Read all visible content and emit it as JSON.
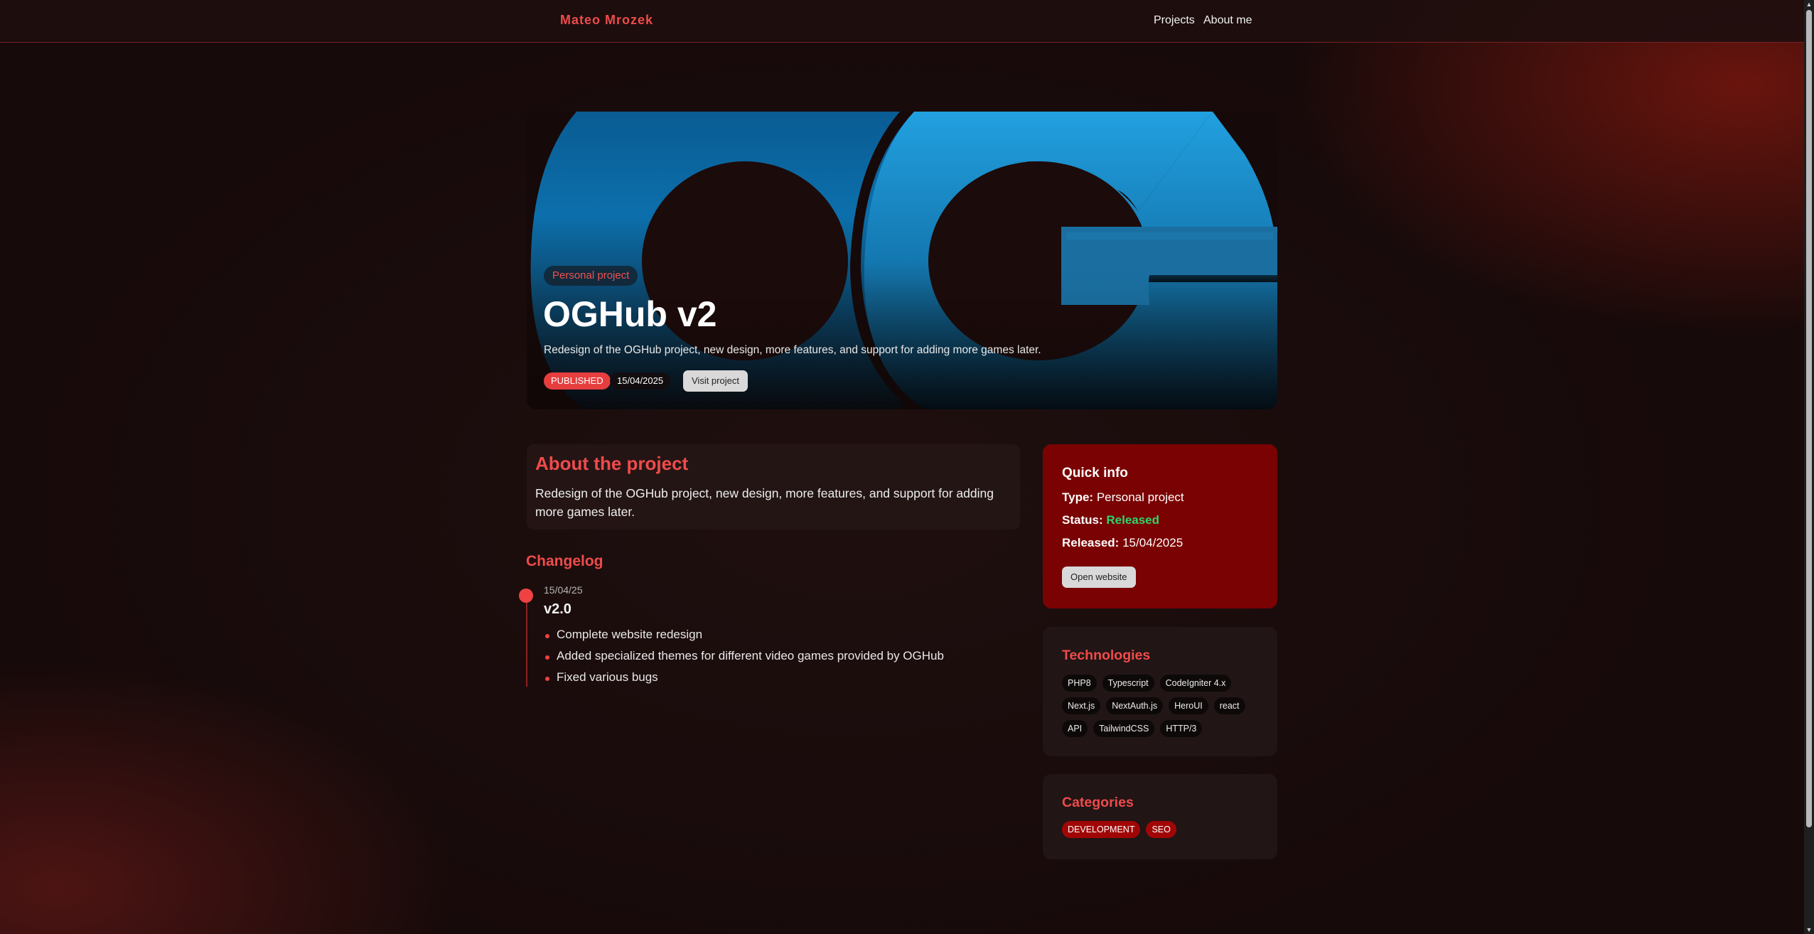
{
  "nav": {
    "brand": "Mateo Mrozek",
    "links": [
      "Projects",
      "About me"
    ]
  },
  "hero": {
    "type_badge": "Personal project",
    "title": "OGHub v2",
    "description": "Redesign of the OGHub project, new design, more features, and support for adding more games later.",
    "status_badge": "PUBLISHED",
    "date_badge": "15/04/2025",
    "visit_button": "Visit project"
  },
  "about": {
    "heading": "About the project",
    "text": "Redesign of the OGHub project, new design, more features, and support for adding more games later."
  },
  "changelog": {
    "heading": "Changelog",
    "entries": [
      {
        "date": "15/04/25",
        "version": "v2.0",
        "items": [
          "Complete website redesign",
          "Added specialized themes for different video games provided by OGHub",
          "Fixed various bugs"
        ]
      }
    ]
  },
  "quick_info": {
    "heading": "Quick info",
    "type_label": "Type:",
    "type_value": "Personal project",
    "status_label": "Status:",
    "status_value": "Released",
    "released_label": "Released:",
    "released_value": "15/04/2025",
    "button": "Open website"
  },
  "technologies": {
    "heading": "Technologies",
    "items": [
      "PHP8",
      "Typescript",
      "CodeIgniter 4.x",
      "Next.js",
      "NextAuth.js",
      "HeroUI",
      "react",
      "API",
      "TailwindCSS",
      "HTTP/3"
    ]
  },
  "categories": {
    "heading": "Categories",
    "items": [
      "DEVELOPMENT",
      "SEO"
    ]
  },
  "colors": {
    "accent": "#ef4b4b",
    "quick_info_bg": "#7a0202",
    "status_green": "#2ed66b",
    "logo_blue": "#1f93d3"
  }
}
